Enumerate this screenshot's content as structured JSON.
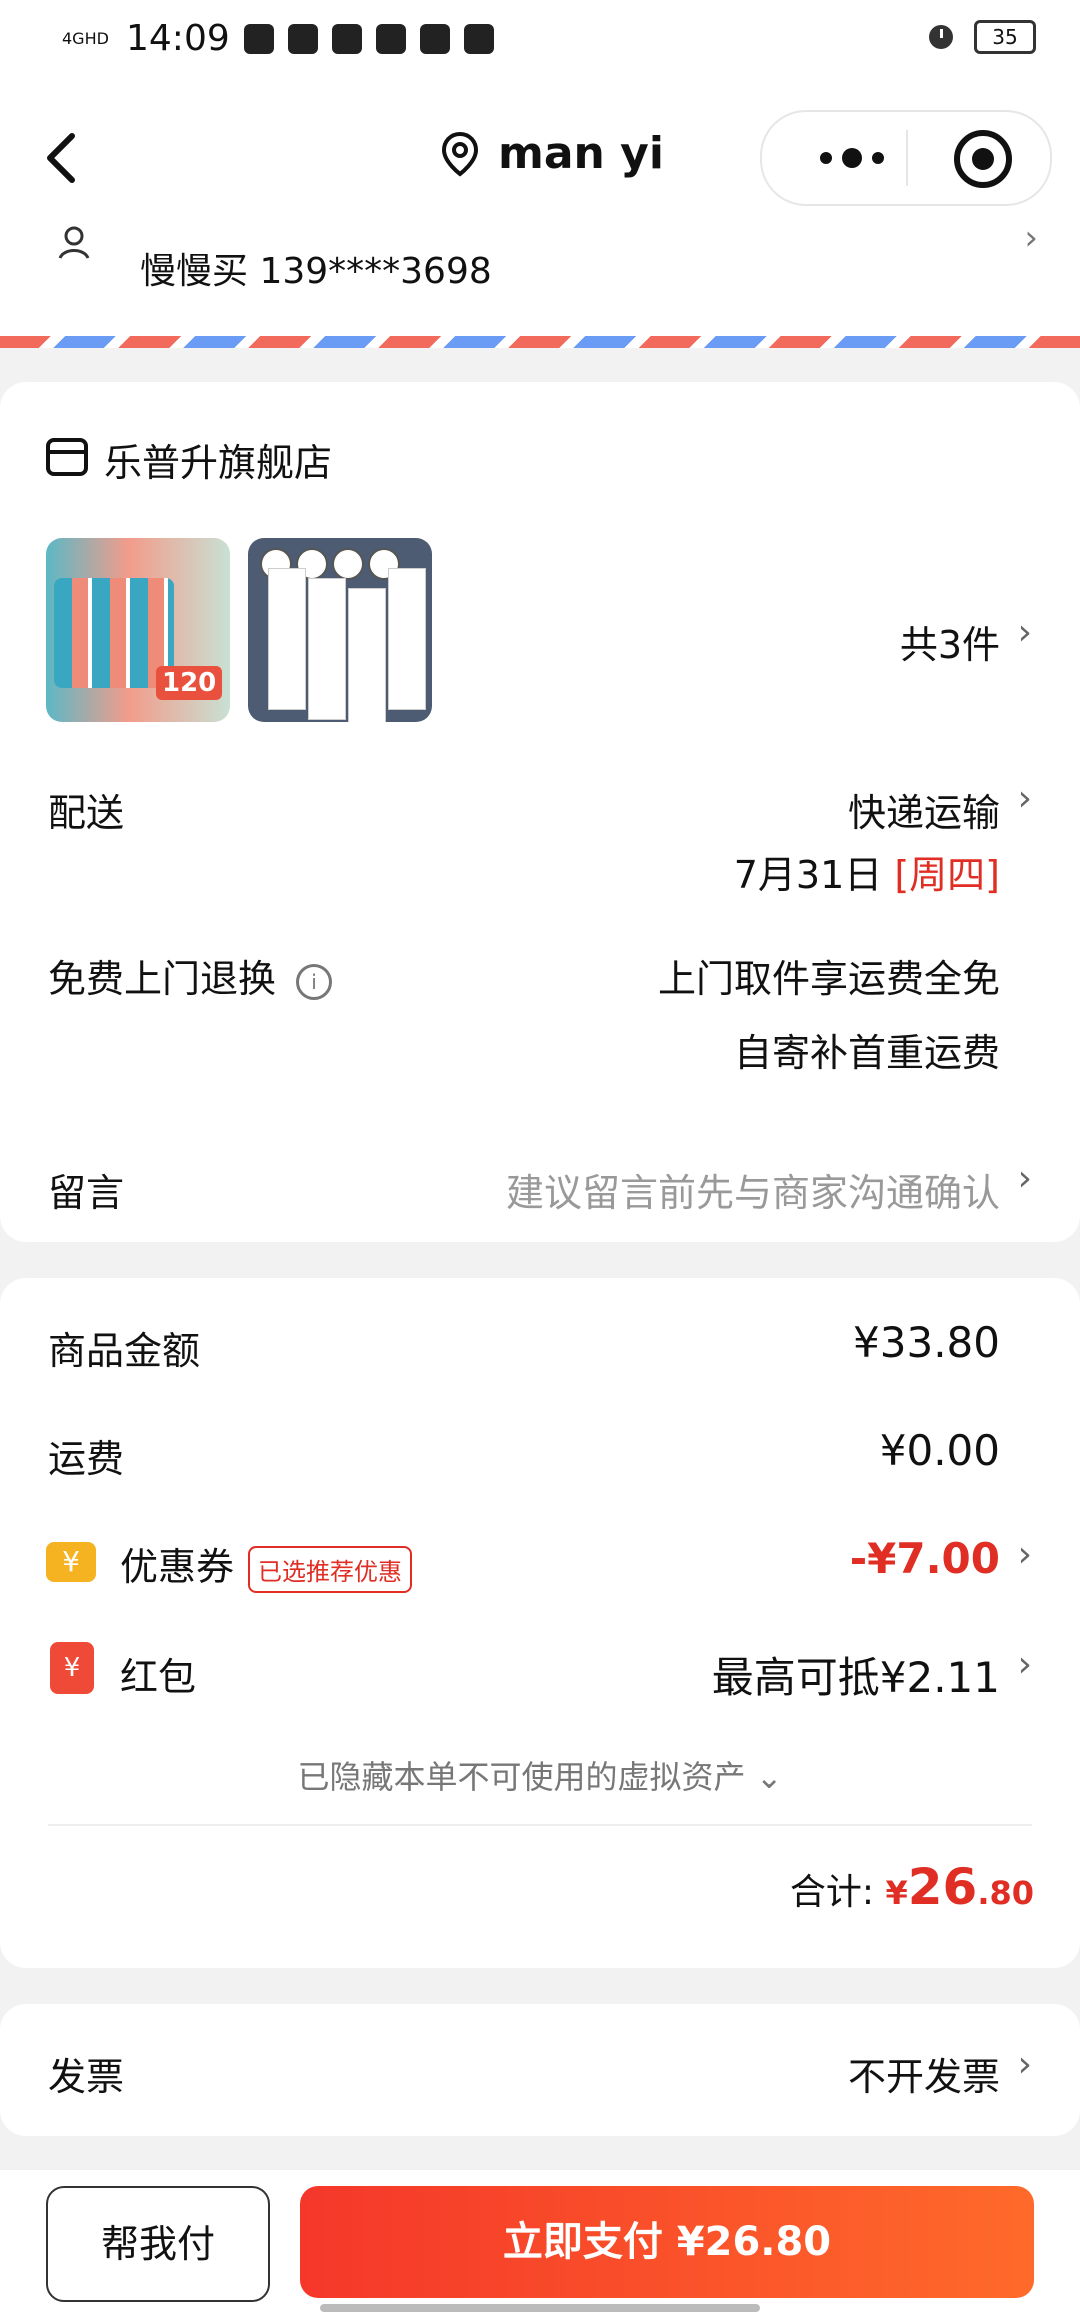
{
  "status": {
    "time": "14:09",
    "signal": "4GHD",
    "battery": "35"
  },
  "nav": {
    "title": "man yi"
  },
  "address": {
    "contact": "慢慢买 139****3698"
  },
  "store": {
    "name": "乐普升旗舰店",
    "thumb1_badge": "120",
    "item_count": "共3件"
  },
  "delivery": {
    "label": "配送",
    "method": "快递运输",
    "date": "7月31日",
    "weekday": "[周四]"
  },
  "returns": {
    "label": "免费上门退换",
    "line1": "上门取件享运费全免",
    "line2": "自寄补首重运费"
  },
  "message": {
    "label": "留言",
    "placeholder": "建议留言前先与商家沟通确认"
  },
  "summary": {
    "goods_label": "商品金额",
    "goods_value": "¥33.80",
    "shipping_label": "运费",
    "shipping_value": "¥0.00",
    "coupon_label": "优惠券",
    "coupon_tag": "已选推荐优惠",
    "coupon_value": "-¥7.00",
    "hongbao_label": "红包",
    "hongbao_value": "最高可抵¥2.11",
    "hidden_assets": "已隐藏本单不可使用的虚拟资产",
    "total_label": "合计:",
    "total_currency": "¥",
    "total_int": "26",
    "total_dec": ".80",
    "coupon_icon": "¥",
    "hongbao_icon": "¥"
  },
  "invoice": {
    "label": "发票",
    "value": "不开发票"
  },
  "actions": {
    "help_pay": "帮我付",
    "pay_now": "立即支付 ¥26.80"
  },
  "colors": {
    "accent_red": "#e02e24",
    "pay_gradient_start": "#f5372a",
    "pay_gradient_end": "#ff6a2a"
  }
}
